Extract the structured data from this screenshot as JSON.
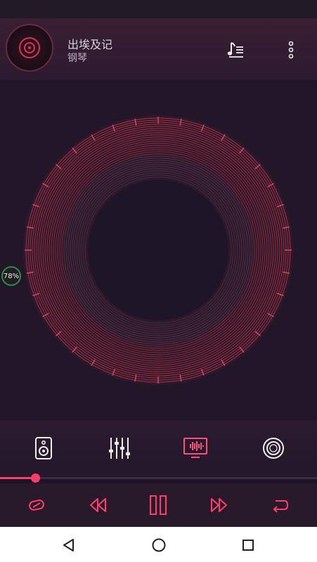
{
  "header": {
    "song_title": "出埃及记",
    "artist": "钢琴"
  },
  "battery": {
    "label": "78%",
    "level": 0.78
  },
  "playback": {
    "progress": 0.11
  },
  "colors": {
    "accent": "#ff3d6b",
    "ring": "#c8354d",
    "background": "#211729",
    "battery_ring": "#2f8a45"
  },
  "icons": {
    "album": "vinyl-disc-icon",
    "playlist": "playlist-music-icon",
    "more": "more-vertical-icon",
    "speaker": "speaker-icon",
    "equalizer": "equalizer-sliders-icon",
    "visualizer": "visualizer-display-icon",
    "surround": "surround-ring-icon",
    "shuffle": "shuffle-icon",
    "previous": "rewind-icon",
    "pause": "pause-icon",
    "next": "fast-forward-icon",
    "repeat": "repeat-icon",
    "back": "nav-back-icon",
    "home": "nav-home-icon",
    "recents": "nav-recents-icon"
  }
}
